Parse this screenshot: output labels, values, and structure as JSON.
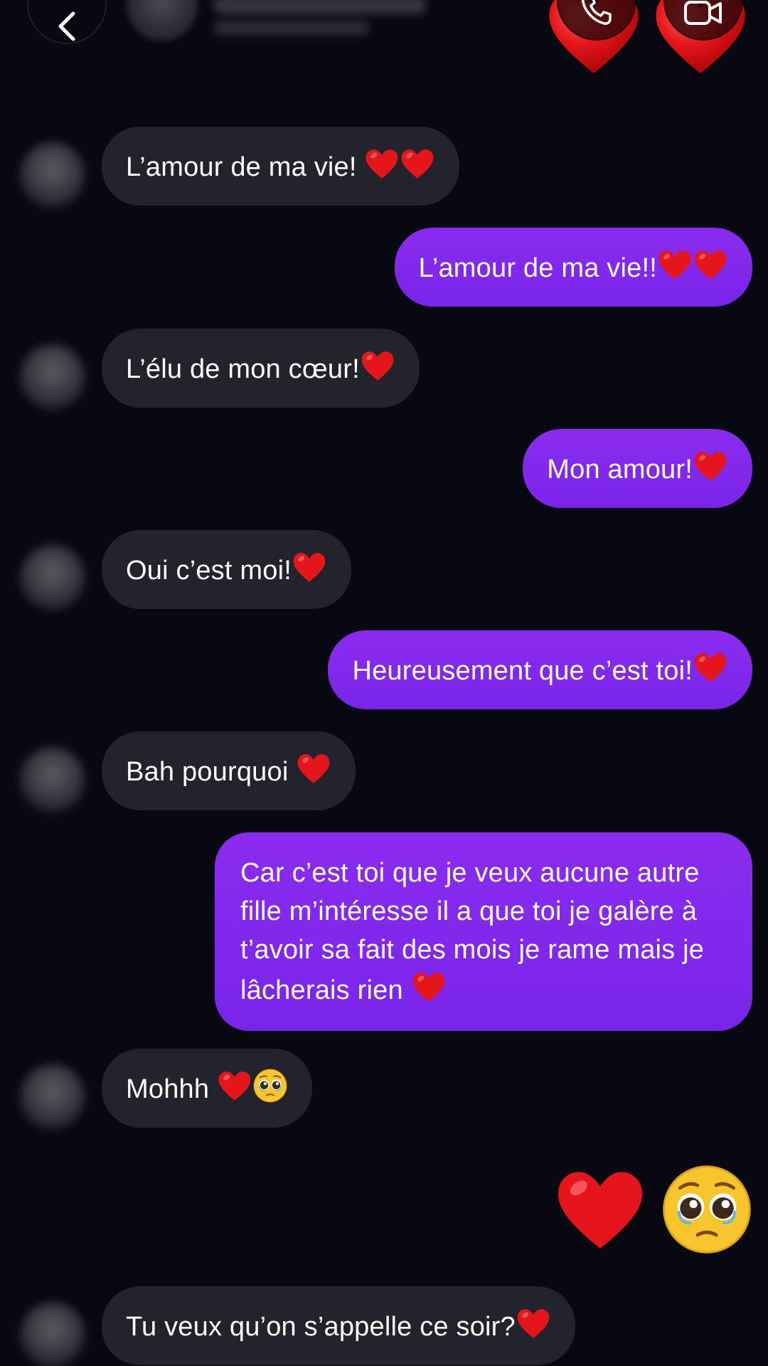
{
  "colors": {
    "background": "#080811",
    "incoming_bubble": "#23232b",
    "outgoing_bubble": "#7e26ec",
    "heart_red": "#e5161b",
    "text": "#ffffff"
  },
  "header": {
    "back_icon": "chevron-left-icon",
    "call_icon": "phone-icon",
    "video_icon": "video-camera-icon",
    "sticker_icon": "red-heart-emoji"
  },
  "messages": [
    {
      "direction": "in",
      "text": "L’amour de ma vie! ",
      "emojis": [
        "heart",
        "heart"
      ]
    },
    {
      "direction": "out",
      "text": "L’amour de ma vie!!",
      "emojis": [
        "heart",
        "heart"
      ]
    },
    {
      "direction": "in",
      "text": "L’élu de mon cœur!",
      "emojis": [
        "heart"
      ]
    },
    {
      "direction": "out",
      "text": "Mon amour!",
      "emojis": [
        "heart"
      ]
    },
    {
      "direction": "in",
      "text": "Oui c’est moi!",
      "emojis": [
        "heart"
      ]
    },
    {
      "direction": "out",
      "text": "Heureusement que c’est toi!",
      "emojis": [
        "heart"
      ]
    },
    {
      "direction": "in",
      "text": "Bah pourquoi ",
      "emojis": [
        "heart"
      ]
    },
    {
      "direction": "out",
      "text": "Car c’est toi que je veux aucune autre fille m’intéresse il a que toi je galère à t’avoir sa fait des mois je rame mais je lâcherais rien ",
      "emojis": [
        "heart"
      ]
    },
    {
      "direction": "in",
      "text": "Mohhh ",
      "emojis": [
        "heart",
        "pleading-face"
      ]
    },
    {
      "direction": "out",
      "text": "",
      "emojis": [
        "heart",
        "pleading-face"
      ],
      "large": true
    },
    {
      "direction": "in",
      "text": "Tu veux qu’on s’appelle ce soir?",
      "emojis": [
        "heart"
      ]
    }
  ]
}
